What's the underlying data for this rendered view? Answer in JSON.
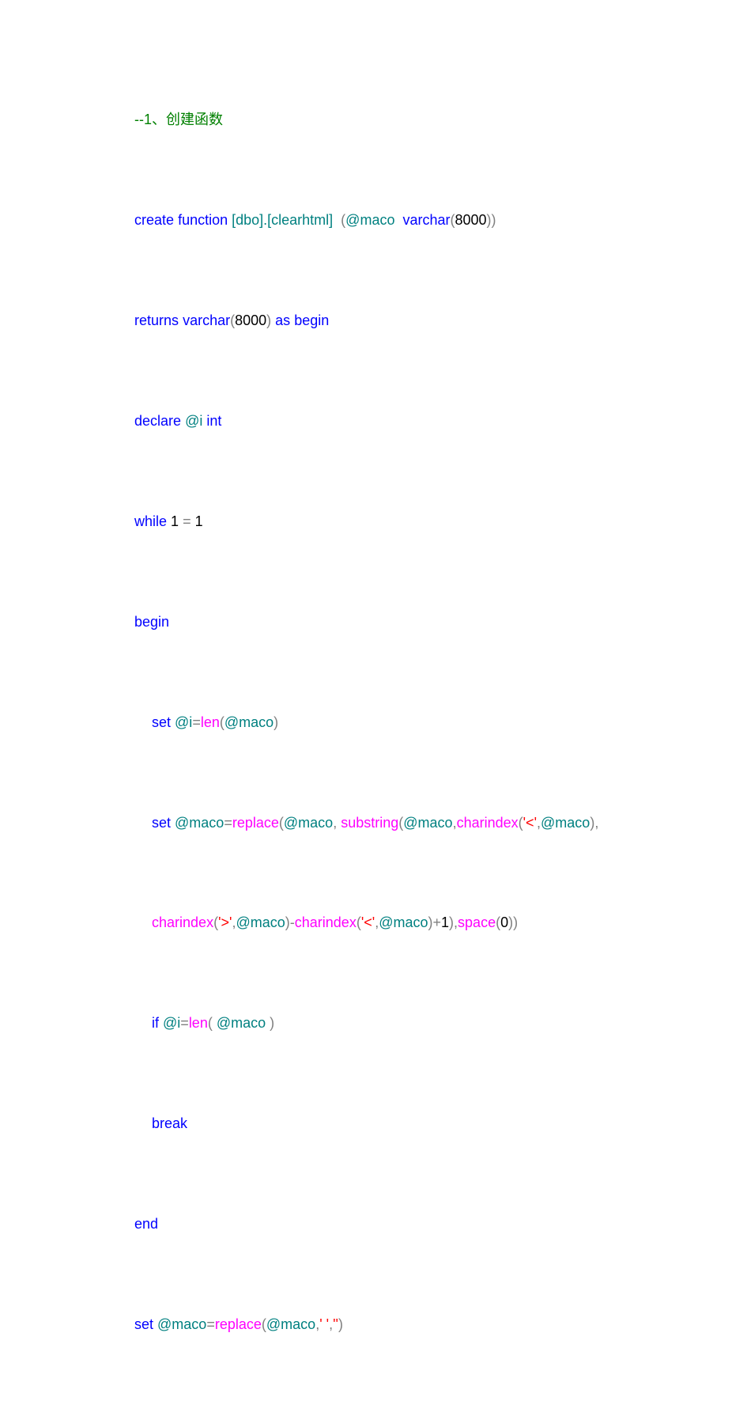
{
  "code": {
    "l1_comment": "--1、创建函数",
    "l2_a": "create",
    "l2_b": "function",
    "l2_c": " [dbo].[clearhtml]  ",
    "l2_d": "(",
    "l2_e": "@maco  ",
    "l2_f": "varchar",
    "l2_g": "(",
    "l2_h": "8000",
    "l2_i": "))",
    "l3_a": "returns",
    "l3_b": "varchar",
    "l3_c": "(",
    "l3_d": "8000",
    "l3_e": ")",
    "l3_f": "as",
    "l3_g": "begin",
    "l4_a": "declare",
    "l4_b": " @i ",
    "l4_c": "int",
    "l5_a": "while",
    "l5_b": " 1 ",
    "l5_c": "=",
    "l5_d": " 1",
    "l6": "begin",
    "l7_a": "set",
    "l7_b": " @i",
    "l7_c": "=",
    "l7_d": "len",
    "l7_e": "(",
    "l7_f": "@maco",
    "l7_g": ")",
    "l8_a": "set",
    "l8_b": " @maco",
    "l8_c": "=",
    "l8_d": "replace",
    "l8_e": "(",
    "l8_f": "@maco",
    "l8_g": ",",
    "l8_h": "substring",
    "l8_i": "(",
    "l8_j": "@maco",
    "l8_k": ",",
    "l8_l": "charindex",
    "l8_m": "(",
    "l8_n": "'<'",
    "l8_o": ",",
    "l8_p": "@maco",
    "l8_q": "),",
    "l9_a": "charindex",
    "l9_b": "(",
    "l9_c": "'>'",
    "l9_d": ",",
    "l9_e": "@maco",
    "l9_f": ")",
    "l9_g": "-",
    "l9_h": "charindex",
    "l9_i": "(",
    "l9_j": "'<'",
    "l9_k": ",",
    "l9_l": "@maco",
    "l9_m": ")",
    "l9_n": "+",
    "l9_o": "1",
    "l9_p": "),",
    "l9_q": "space",
    "l9_r": "(",
    "l9_s": "0",
    "l9_t": "))",
    "l10_a": "if",
    "l10_b": " @i",
    "l10_c": "=",
    "l10_d": "len",
    "l10_e": "(",
    "l10_f": " @maco ",
    "l10_g": ")",
    "l11": "break",
    "l12": "end",
    "l13_a": "set",
    "l13_b": " @maco",
    "l13_c": "=",
    "l13_d": "replace",
    "l13_e": "(",
    "l13_f": "@maco",
    "l13_g": ",",
    "l13_h": "' '",
    "l13_i": ",",
    "l13_j": "''",
    "l13_k": ")"
  }
}
